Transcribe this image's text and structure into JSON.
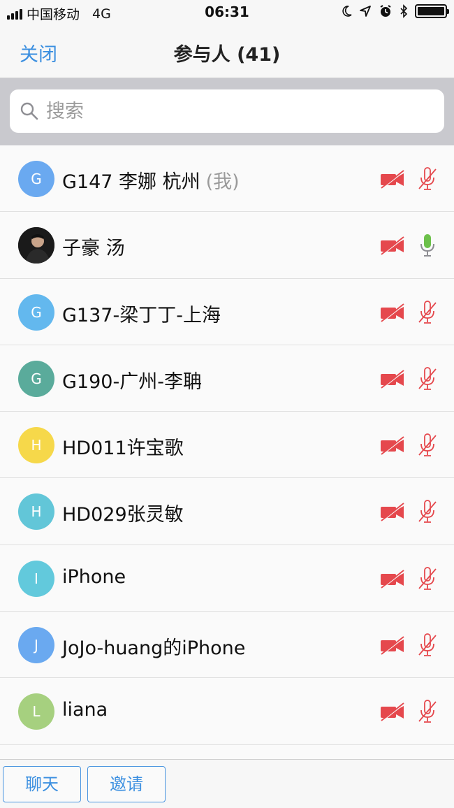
{
  "status_bar": {
    "carrier": "中国移动",
    "network": "4G",
    "time": "06:31"
  },
  "nav": {
    "close_label": "关闭",
    "title": "参与人 (41)"
  },
  "search": {
    "placeholder": "搜索"
  },
  "participants": [
    {
      "initial": "G",
      "name": "G147 李娜 杭州",
      "suffix": "(我)",
      "avatar_color": "#6aa9f0",
      "mic": "muted",
      "video": "off"
    },
    {
      "initial": "",
      "name": "子豪 汤",
      "suffix": "",
      "avatar_color": "#1d1d1d",
      "photo": true,
      "mic": "on",
      "video": "off"
    },
    {
      "initial": "G",
      "name": "G137-梁丁丁-上海",
      "suffix": "",
      "avatar_color": "#63b8ee",
      "mic": "muted",
      "video": "off"
    },
    {
      "initial": "G",
      "name": "G190-广州-李聃",
      "suffix": "",
      "avatar_color": "#5aab9b",
      "mic": "muted",
      "video": "off"
    },
    {
      "initial": "H",
      "name": "HD011许宝歌",
      "suffix": "",
      "avatar_color": "#f6d84a",
      "mic": "muted",
      "video": "off"
    },
    {
      "initial": "H",
      "name": "HD029张灵敏",
      "suffix": "",
      "avatar_color": "#62c6d8",
      "mic": "muted",
      "video": "off"
    },
    {
      "initial": "I",
      "name": "iPhone",
      "suffix": "",
      "avatar_color": "#62c9dc",
      "mic": "muted",
      "video": "off"
    },
    {
      "initial": "J",
      "name": "JoJo-huang的iPhone",
      "suffix": "",
      "avatar_color": "#6aa9f0",
      "mic": "muted",
      "video": "off"
    },
    {
      "initial": "L",
      "name": "liana",
      "suffix": "",
      "avatar_color": "#a6d07f",
      "mic": "muted",
      "video": "off"
    }
  ],
  "bottom": {
    "chat_label": "聊天",
    "invite_label": "邀请"
  },
  "colors": {
    "accent": "#3b8fe0",
    "muted_red": "#e5484d",
    "mic_on_green": "#6cc04a"
  }
}
